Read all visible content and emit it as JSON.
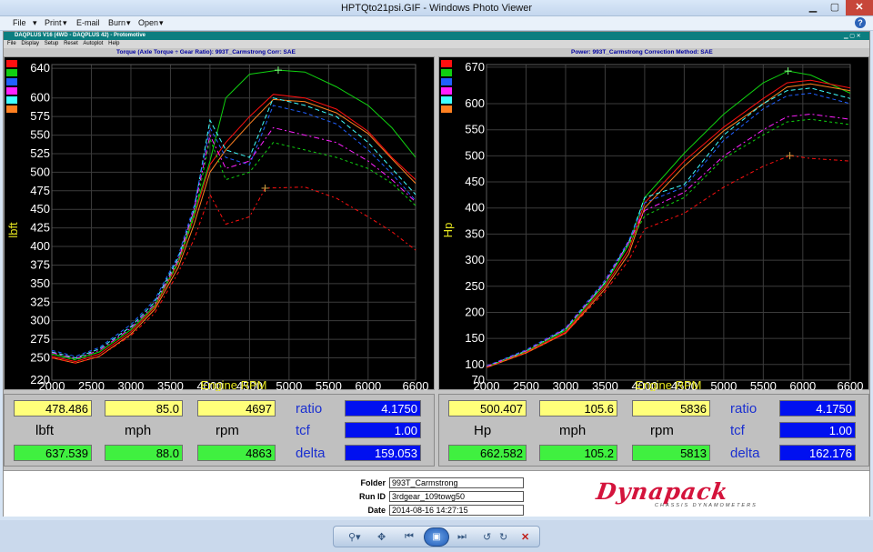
{
  "window": {
    "title": "HPTQto21psi.GIF - Windows Photo Viewer",
    "menu": [
      "File",
      "Print",
      "E-mail",
      "Burn",
      "Open"
    ]
  },
  "app": {
    "title": "DAQPLUS V16 (4WD - DAQPLUS 42) - Protomotive",
    "menu": [
      "File",
      "Display",
      "Setup",
      "Reset",
      "Autoplot",
      "Help"
    ]
  },
  "left_chart_title": "Torque (Axle Torque ÷ Gear Ratio): 993T_Carmstrong      Corr: SAE",
  "right_chart_title": "Power: 993T_Carmstrong      Correction Method: SAE",
  "legend_colors": [
    "#ff1010",
    "#10d010",
    "#2060ff",
    "#ff20ff",
    "#40ffff",
    "#ff8020"
  ],
  "left_panel": {
    "top_values": [
      "478.486",
      "85.0",
      "4697"
    ],
    "labels": [
      "lbft",
      "mph",
      "rpm"
    ],
    "bottom_values": [
      "637.539",
      "88.0",
      "4863"
    ],
    "ratio_label": "ratio",
    "ratio": "4.1750",
    "tcf_label": "tcf",
    "tcf": "1.00",
    "delta_label": "delta",
    "delta": "159.053"
  },
  "right_panel": {
    "top_values": [
      "500.407",
      "105.6",
      "5836"
    ],
    "labels": [
      "Hp",
      "mph",
      "rpm"
    ],
    "bottom_values": [
      "662.582",
      "105.2",
      "5813"
    ],
    "ratio_label": "ratio",
    "ratio": "4.1750",
    "tcf_label": "tcf",
    "tcf": "1.00",
    "delta_label": "delta",
    "delta": "162.176"
  },
  "info": {
    "folder_label": "Folder",
    "folder": "993T_Carmstrong",
    "runid_label": "Run ID",
    "runid": "3rdgear_109towg50",
    "date_label": "Date",
    "date": "2014-08-16 14:27:15",
    "logo": "Dynapack",
    "logo_sub": "CHASSIS DYNAMOMETERS"
  },
  "chart_data": [
    {
      "type": "line",
      "xlabel": "Engine RPM",
      "ylabel": "lbft",
      "xlim": [
        2000,
        6600
      ],
      "ylim": [
        220,
        645
      ],
      "xticks": [
        2000,
        2500,
        3000,
        3500,
        4000,
        4500,
        5000,
        5500,
        6000,
        6600
      ],
      "yticks": [
        220,
        250,
        275,
        300,
        325,
        350,
        375,
        400,
        425,
        450,
        475,
        500,
        525,
        550,
        575,
        600,
        640
      ],
      "grid": true,
      "markers": [
        {
          "x": 4863,
          "y": 637.5
        },
        {
          "x": 4697,
          "y": 478.5
        }
      ],
      "series": [
        {
          "color": "#10d010",
          "x": [
            2000,
            2300,
            2600,
            3000,
            3300,
            3600,
            3800,
            4000,
            4200,
            4500,
            4863,
            5200,
            5600,
            6000,
            6300,
            6600
          ],
          "values": [
            255,
            248,
            258,
            288,
            320,
            380,
            445,
            515,
            600,
            632,
            637.5,
            635,
            615,
            590,
            560,
            520
          ]
        },
        {
          "color": "#ff1010",
          "x": [
            2000,
            2300,
            2600,
            3000,
            3300,
            3600,
            3800,
            4000,
            4200,
            4500,
            4800,
            5200,
            5600,
            6000,
            6300,
            6600
          ],
          "values": [
            252,
            245,
            255,
            285,
            318,
            378,
            440,
            510,
            540,
            575,
            605,
            600,
            585,
            555,
            520,
            490
          ]
        },
        {
          "color": "#ff8020",
          "x": [
            2000,
            2300,
            2600,
            3000,
            3300,
            3600,
            3800,
            4000,
            4200,
            4500,
            4800,
            5200,
            5600,
            6000,
            6300,
            6600
          ],
          "values": [
            250,
            243,
            252,
            282,
            315,
            372,
            430,
            500,
            530,
            565,
            598,
            595,
            580,
            552,
            518,
            485
          ]
        },
        {
          "color": "#40ffff",
          "x": [
            2000,
            2300,
            2600,
            3000,
            3300,
            3600,
            3800,
            4000,
            4200,
            4500,
            4800,
            5200,
            5600,
            6000,
            6300,
            6600
          ],
          "values": [
            258,
            250,
            262,
            292,
            325,
            385,
            450,
            570,
            530,
            520,
            600,
            590,
            575,
            540,
            505,
            470
          ]
        },
        {
          "color": "#2060ff",
          "x": [
            2000,
            2300,
            2600,
            3000,
            3300,
            3600,
            3800,
            4000,
            4200,
            4500,
            4800,
            5200,
            5600,
            6000,
            6300,
            6600
          ],
          "values": [
            260,
            252,
            264,
            295,
            328,
            388,
            455,
            560,
            520,
            510,
            590,
            580,
            565,
            530,
            498,
            462
          ]
        },
        {
          "color": "#ff20ff",
          "x": [
            2000,
            2300,
            2600,
            3000,
            3300,
            3600,
            3800,
            4000,
            4200,
            4500,
            4800,
            5200,
            5600,
            6000,
            6300,
            6600
          ],
          "values": [
            257,
            249,
            260,
            290,
            322,
            382,
            450,
            550,
            505,
            515,
            560,
            550,
            540,
            515,
            490,
            460
          ]
        },
        {
          "color": "#10d010",
          "x": [
            2000,
            2300,
            2600,
            3000,
            3300,
            3600,
            3800,
            4000,
            4200,
            4500,
            4800,
            5200,
            5600,
            6000,
            6300,
            6600
          ],
          "values": [
            255,
            247,
            258,
            288,
            320,
            378,
            440,
            545,
            490,
            500,
            540,
            530,
            520,
            505,
            485,
            455
          ]
        },
        {
          "color": "#ff1010",
          "x": [
            2000,
            2300,
            2600,
            3000,
            3300,
            3600,
            3800,
            4000,
            4200,
            4500,
            4700,
            5200,
            5600,
            6000,
            6300,
            6600
          ],
          "values": [
            250,
            243,
            252,
            280,
            310,
            365,
            410,
            470,
            430,
            440,
            478.5,
            480,
            465,
            440,
            420,
            395
          ]
        }
      ]
    },
    {
      "type": "line",
      "xlabel": "Engine RPM",
      "ylabel": "Hp",
      "xlim": [
        2000,
        6600
      ],
      "ylim": [
        70,
        675
      ],
      "xticks": [
        2000,
        2500,
        3000,
        3500,
        4000,
        4500,
        5000,
        5500,
        6000,
        6600
      ],
      "yticks": [
        70,
        100,
        150,
        200,
        250,
        300,
        350,
        400,
        450,
        500,
        550,
        600,
        670
      ],
      "grid": true,
      "markers": [
        {
          "x": 5813,
          "y": 662.6
        },
        {
          "x": 5836,
          "y": 500.4
        }
      ],
      "series": [
        {
          "color": "#10d010",
          "x": [
            2000,
            2500,
            3000,
            3500,
            3800,
            4000,
            4500,
            5000,
            5500,
            5813,
            6100,
            6600
          ],
          "values": [
            95,
            125,
            165,
            255,
            330,
            420,
            505,
            580,
            640,
            662.6,
            655,
            620
          ]
        },
        {
          "color": "#ff1010",
          "x": [
            2000,
            2500,
            3000,
            3500,
            3800,
            4000,
            4500,
            5000,
            5500,
            5800,
            6100,
            6600
          ],
          "values": [
            95,
            123,
            162,
            250,
            320,
            410,
            490,
            555,
            610,
            640,
            645,
            630
          ]
        },
        {
          "color": "#ff8020",
          "x": [
            2000,
            2500,
            3000,
            3500,
            3800,
            4000,
            4500,
            5000,
            5500,
            5800,
            6100,
            6600
          ],
          "values": [
            94,
            122,
            160,
            245,
            312,
            400,
            480,
            548,
            600,
            632,
            638,
            625
          ]
        },
        {
          "color": "#40ffff",
          "x": [
            2000,
            2500,
            3000,
            3500,
            3800,
            4000,
            4500,
            5000,
            5500,
            5800,
            6100,
            6600
          ],
          "values": [
            96,
            126,
            168,
            258,
            335,
            420,
            445,
            540,
            600,
            625,
            630,
            610
          ]
        },
        {
          "color": "#2060ff",
          "x": [
            2000,
            2500,
            3000,
            3500,
            3800,
            4000,
            4500,
            5000,
            5500,
            5800,
            6100,
            6600
          ],
          "values": [
            97,
            128,
            170,
            262,
            338,
            410,
            440,
            530,
            590,
            615,
            620,
            600
          ]
        },
        {
          "color": "#ff20ff",
          "x": [
            2000,
            2500,
            3000,
            3500,
            3800,
            4000,
            4500,
            5000,
            5500,
            5800,
            6100,
            6600
          ],
          "values": [
            96,
            126,
            168,
            258,
            335,
            395,
            430,
            500,
            550,
            575,
            580,
            570
          ]
        },
        {
          "color": "#10d010",
          "x": [
            2000,
            2500,
            3000,
            3500,
            3800,
            4000,
            4500,
            5000,
            5500,
            5800,
            6100,
            6600
          ],
          "values": [
            95,
            125,
            166,
            255,
            330,
            385,
            420,
            495,
            540,
            565,
            570,
            560
          ]
        },
        {
          "color": "#ff1010",
          "x": [
            2000,
            2500,
            3000,
            3500,
            3800,
            4000,
            4500,
            5000,
            5500,
            5836,
            6100,
            6600
          ],
          "values": [
            94,
            122,
            160,
            240,
            300,
            360,
            390,
            440,
            480,
            500.4,
            495,
            490
          ]
        }
      ]
    }
  ]
}
